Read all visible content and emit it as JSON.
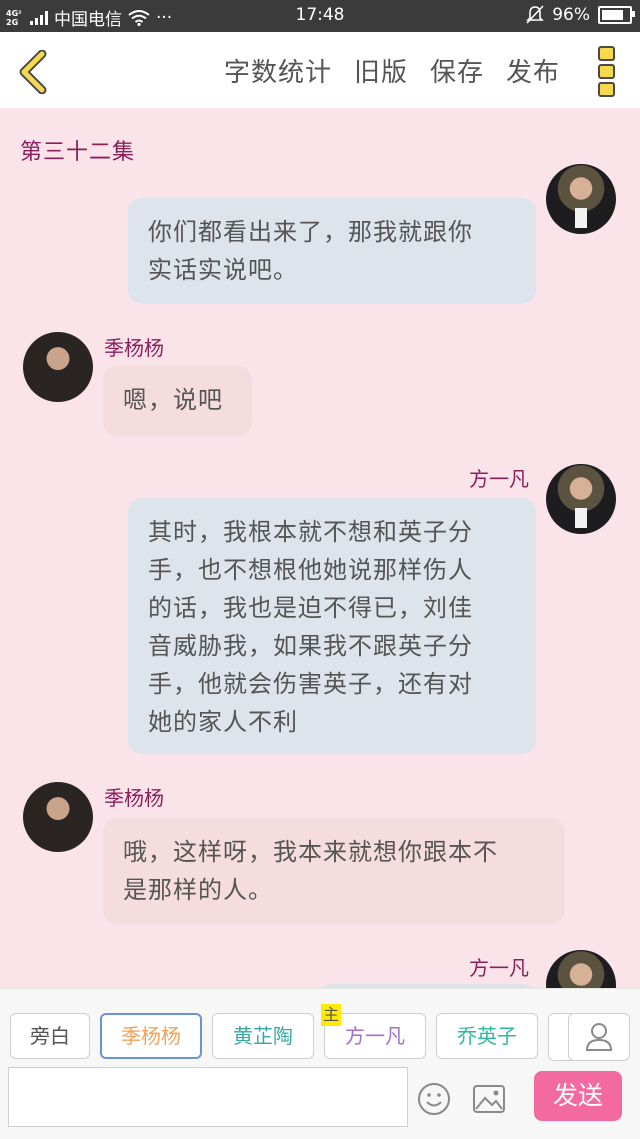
{
  "status_bar": {
    "network_badge_top": "4G²",
    "network_badge_bottom": "2G",
    "carrier": "中国电信",
    "more": "···",
    "time": "17:48",
    "battery_percent": "96%",
    "battery_level": 0.96
  },
  "nav": {
    "back_icon": "chevron-left-icon",
    "actions": [
      "字数统计",
      "旧版",
      "保存",
      "发布"
    ],
    "more_icon": "three-squares-icon"
  },
  "chat": {
    "episode_title": "第三十二集",
    "messages": [
      {
        "side": "right",
        "speaker": "",
        "text_lines": [
          "你们都看出来了，那我就跟你",
          "实话实说吧。"
        ]
      },
      {
        "side": "left",
        "speaker": "季杨杨",
        "text_lines": [
          "嗯，说吧"
        ]
      },
      {
        "side": "right",
        "speaker": "方一凡",
        "text_lines": [
          "其时，我根本就不想和英子分",
          "手，也不想根他她说那样伤人",
          "的话，我也是迫不得已，刘佳",
          "音威胁我，如果我不跟英子分",
          "手，他就会伤害英子，还有对",
          "她的家人不利"
        ]
      },
      {
        "side": "left",
        "speaker": "季杨杨",
        "text_lines": [
          "哦，这样呀，我本来就想你跟本不",
          "是那样的人。"
        ]
      },
      {
        "side": "right",
        "speaker": "方一凡",
        "text_lines": []
      }
    ]
  },
  "roles": {
    "items": [
      {
        "label": "旁白",
        "color": "#555555"
      },
      {
        "label": "季杨杨",
        "color": "#f0a15a",
        "selected": true
      },
      {
        "label": "黄芷陶",
        "color": "#3aa8a0"
      },
      {
        "label": "方一凡",
        "color": "#a26fd1",
        "tag": "主"
      },
      {
        "label": "乔英子",
        "color": "#2fb79f"
      }
    ],
    "user_icon": "user-icon"
  },
  "composer": {
    "input_value": "",
    "emoji_icon": "smiley-icon",
    "image_icon": "image-icon",
    "send_label": "发送"
  },
  "colors": {
    "chat_background": "#fbe3ea",
    "speaker_name": "#8a1f5a",
    "right_bubble": "#dde4ec",
    "left_bubble": "#f5dcdd",
    "send_button": "#f26a9f"
  }
}
